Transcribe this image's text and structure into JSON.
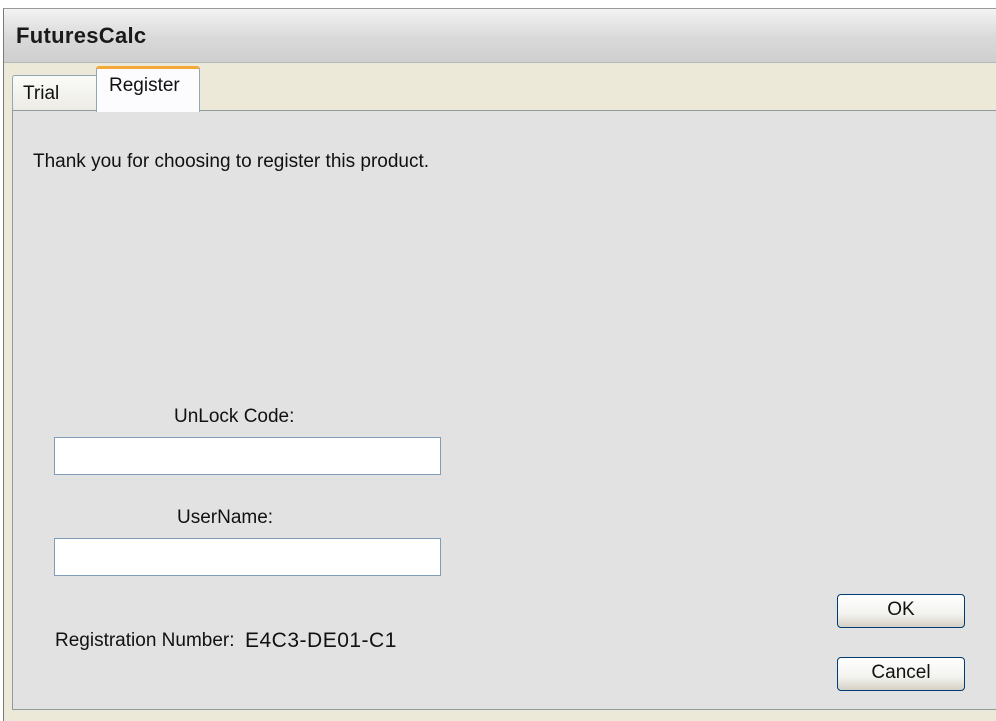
{
  "window": {
    "title": "FuturesCalc"
  },
  "tabs": [
    {
      "label": "Trial",
      "selected": false
    },
    {
      "label": "Register",
      "selected": true
    }
  ],
  "register": {
    "message": "Thank you for choosing to register this product.",
    "unlock_code_label": "UnLock Code:",
    "unlock_code_value": "",
    "username_label": "UserName:",
    "username_value": "",
    "registration_number_label": "Registration Number:",
    "registration_number_value": "E4C3-DE01-C1"
  },
  "buttons": {
    "ok_label": "OK",
    "cancel_label": "Cancel"
  },
  "colors": {
    "active_tab_accent": "#f3a93a",
    "panel_background": "#e2e2e2",
    "button_border": "#003c74"
  }
}
